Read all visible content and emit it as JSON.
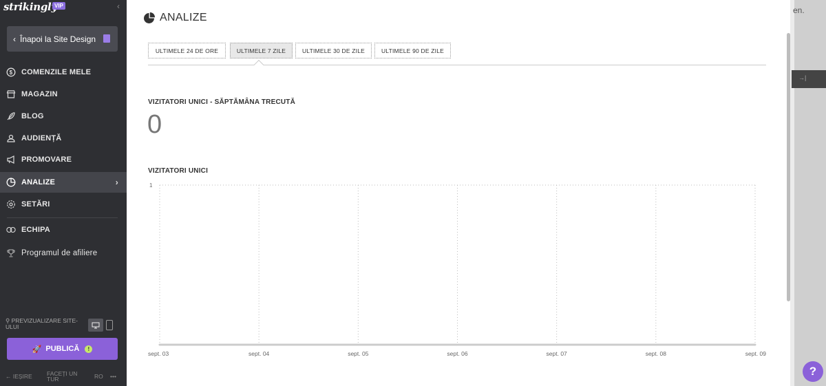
{
  "sidebar": {
    "logo": "strikingly",
    "vip": "VIP",
    "back_button": "Înapoi la Site Design",
    "items": [
      {
        "label": "COMENZILE MELE",
        "icon": "dollar-circle-icon"
      },
      {
        "label": "MAGAZIN",
        "icon": "store-icon"
      },
      {
        "label": "BLOG",
        "icon": "feather-icon"
      },
      {
        "label": "AUDIENȚĂ",
        "icon": "people-icon"
      },
      {
        "label": "PROMOVARE",
        "icon": "megaphone-icon"
      },
      {
        "label": "ANALIZE",
        "icon": "pie-chart-icon",
        "active": true
      },
      {
        "label": "SETĂRI",
        "icon": "gear-icon"
      },
      {
        "label": "ECHIPA",
        "icon": "team-icon"
      },
      {
        "label": "Programul de afiliere",
        "icon": "trophy-icon"
      }
    ],
    "preview_label": "PREVIZUALIZARE SITE-ULUI",
    "publish_button": "PUBLICĂ",
    "publish_badge": "!",
    "footer": {
      "exit": "← IEȘIRE",
      "tour": "FACEȚI UN TUR",
      "lang": "RO",
      "more": "•••"
    }
  },
  "main": {
    "title": "ANALIZE",
    "tabs": [
      {
        "label": "ULTIMELE 24 DE ORE",
        "active": false
      },
      {
        "label": "ULTIMELE 7 ZILE",
        "active": true
      },
      {
        "label": "ULTIMELE 30 DE ZILE",
        "active": false
      },
      {
        "label": "ULTIMELE 90 DE ZILE",
        "active": false
      }
    ],
    "unique_visitors_week_label": "VIZITATORI UNICI - SĂPTĂMÂNA TRECUTĂ",
    "unique_visitors_week_value": "0",
    "chart_label": "VIZITATORI UNICI"
  },
  "chart_data": {
    "type": "line",
    "title": "VIZITATORI UNICI",
    "categories": [
      "sept. 03",
      "sept. 04",
      "sept. 05",
      "sept. 06",
      "sept. 07",
      "sept. 08",
      "sept. 09"
    ],
    "series": [
      {
        "values": [
          0,
          0,
          0,
          0,
          0,
          0,
          0
        ]
      }
    ],
    "ylim": [
      0,
      1
    ],
    "yticks": [
      "1"
    ],
    "grid": true,
    "colors": {
      "line": "#cccccc",
      "grid": "#bbbbbb"
    }
  },
  "overlay": {
    "bg_text": "en.",
    "bg_dark_text": "→|",
    "help": "?"
  },
  "colors": {
    "accent": "#8b61d9",
    "sidebar": "#2e2f33"
  }
}
